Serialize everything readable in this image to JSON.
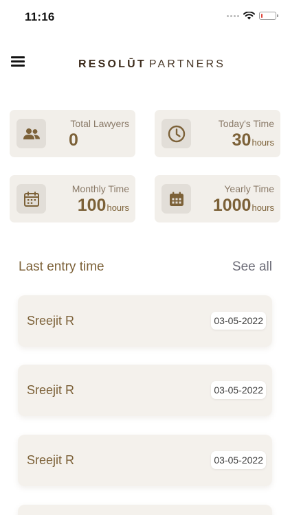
{
  "status_bar": {
    "time": "11:16"
  },
  "header": {
    "brand_strong": "RESOLŪT",
    "brand_light": "PARTNERS"
  },
  "stats": [
    {
      "label": "Total Lawyers",
      "value": "0",
      "unit": "",
      "icon": "users-icon"
    },
    {
      "label": "Today's Time",
      "value": "30",
      "unit": "hours",
      "icon": "clock-icon"
    },
    {
      "label": "Monthly Time",
      "value": "100",
      "unit": "hours",
      "icon": "calendar-icon"
    },
    {
      "label": "Yearly Time",
      "value": "1000",
      "unit": "hours",
      "icon": "calendar-grid-icon"
    }
  ],
  "last_entry": {
    "title": "Last entry time",
    "see_all": "See all",
    "items": [
      {
        "name": "Sreejit R",
        "date": "03-05-2022"
      },
      {
        "name": "Sreejit R",
        "date": "03-05-2022"
      },
      {
        "name": "Sreejit R",
        "date": "03-05-2022"
      }
    ]
  },
  "colors": {
    "accent": "#7c6138",
    "card_bg": "#f2efea",
    "icon_bg": "#e2ded8",
    "battery_low": "#e0443a"
  }
}
